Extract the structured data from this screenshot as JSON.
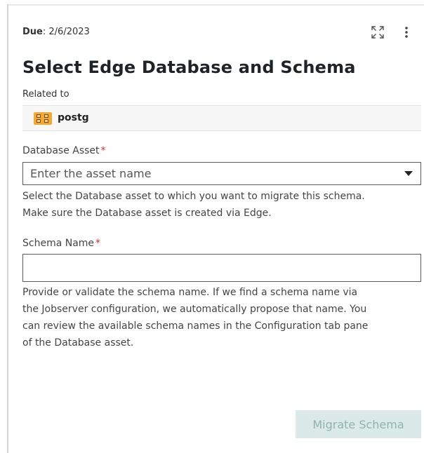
{
  "header": {
    "due_label": "Due",
    "due_date": "2/6/2023"
  },
  "icons": {
    "expand": "expand-icon",
    "more": "more-vertical-icon",
    "asset": "database-asset-icon"
  },
  "title": "Select Edge Database and Schema",
  "related": {
    "label": "Related to",
    "asset_name": "postg"
  },
  "database_asset": {
    "label": "Database Asset",
    "required_mark": "*",
    "placeholder": "Enter the asset name",
    "help_line1": "Select the Database asset to which you want to migrate this schema.",
    "help_line2": "Make sure the Database asset is created via Edge."
  },
  "schema_name": {
    "label": "Schema Name",
    "required_mark": "*",
    "value": "",
    "help_line1": "Provide or validate the schema name. If we find a schema name via",
    "help_line2": "the Jobserver configuration, we automatically propose that name. You",
    "help_line3": "can review the available schema names in the Configuration tab pane",
    "help_line4": "of the Database asset."
  },
  "actions": {
    "migrate_label": "Migrate Schema"
  },
  "colors": {
    "required": "#d32f2f",
    "asset_icon": "#f3a92f",
    "button_disabled_bg": "#dbeae8",
    "button_disabled_text": "#8fb3ae"
  }
}
